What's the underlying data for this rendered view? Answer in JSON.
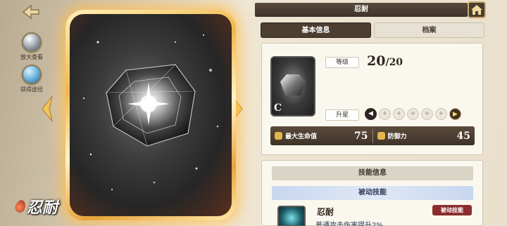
{
  "sidebar": {
    "buttons": [
      {
        "label": "放大查看",
        "icon": "magnify-icon"
      },
      {
        "label": "获得途径",
        "icon": "source-icon"
      }
    ]
  },
  "card": {
    "name": "忍耐"
  },
  "header": {
    "title": "忍耐",
    "home_icon": "home-icon"
  },
  "tabs": [
    {
      "label": "基本信息",
      "active": true
    },
    {
      "label": "档案",
      "active": false
    }
  ],
  "info": {
    "level_label": "等级",
    "level_current": "20",
    "level_max": "/20",
    "star_label": "升星",
    "star_count": 5,
    "rarity_letter": "C",
    "stats": [
      {
        "name": "最大生命值",
        "value": "75"
      },
      {
        "name": "防御力",
        "value": "45"
      }
    ]
  },
  "skills": {
    "title": "技能信息",
    "passive_header": "被动技能",
    "items": [
      {
        "name": "忍耐",
        "tag": "被动技能",
        "description": "普通攻击伤害提升2%"
      }
    ]
  },
  "colors": {
    "panel_dark": "#4d3e32",
    "passive_blue": "#c8d6ee",
    "tag_red": "#8b2d2d",
    "card_glow": "#f0b84a"
  }
}
